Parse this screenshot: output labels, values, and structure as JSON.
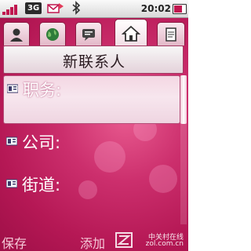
{
  "status_bar": {
    "network": "3G",
    "time": "20:02",
    "icons": [
      "signal-icon",
      "3g-icon",
      "message-icon",
      "bluetooth-icon",
      "battery-icon"
    ]
  },
  "tabs": [
    {
      "name": "contacts",
      "icon": "person-icon",
      "active": false
    },
    {
      "name": "web",
      "icon": "globe-icon",
      "active": false
    },
    {
      "name": "messages",
      "icon": "chat-icon",
      "active": false
    },
    {
      "name": "home",
      "icon": "home-icon",
      "active": true
    },
    {
      "name": "notes",
      "icon": "note-icon",
      "active": false
    }
  ],
  "page": {
    "title": "新联系人"
  },
  "fields": [
    {
      "label": "职务:",
      "value": "",
      "icon": "contact-card-icon"
    },
    {
      "label": "公司:",
      "value": "",
      "icon": "contact-card-icon"
    },
    {
      "label": "街道:",
      "value": "",
      "icon": "contact-card-icon"
    }
  ],
  "softkeys": {
    "left": "保存",
    "center": "添加"
  },
  "watermark": {
    "line1": "中关村在线",
    "line2": "zol.com.cn"
  },
  "colors": {
    "background": "#c2215f",
    "accent": "#c0174f",
    "softkey_text": "#f5c9d8"
  }
}
